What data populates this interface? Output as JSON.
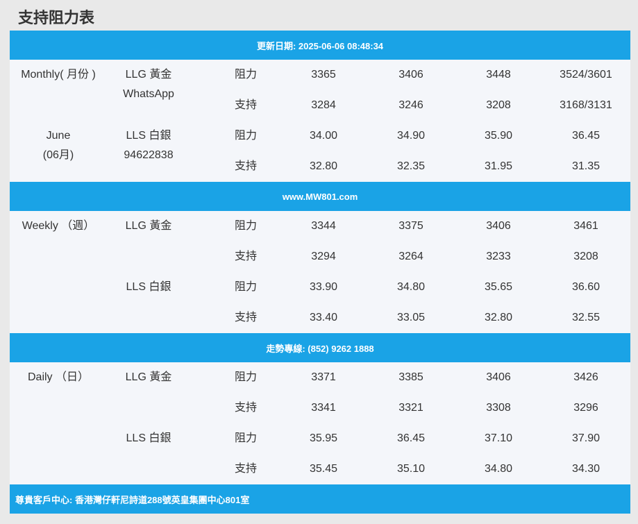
{
  "page_title": "支持阻力表",
  "header_bar": "更新日期: 2025-06-06 08:48:34",
  "mid_bar_1": "www.MW801.com",
  "mid_bar_2": "走勢專線: (852) 9262 1888",
  "footer_bar": "尊貴客戶中心: 香港灣仔軒尼詩道288號英皇集團中心801室",
  "type_labels": {
    "resistance": "阻力",
    "support": "支持"
  },
  "monthly": {
    "period_line1": "Monthly( 月份 )",
    "period_line2": "June",
    "period_line3": "(06月)",
    "gold_label": "LLG 黃金",
    "gold_sub": "WhatsApp",
    "silver_label": "LLS 白銀",
    "silver_sub": "94622838",
    "rows": [
      [
        "3365",
        "3406",
        "3448",
        "3524/3601"
      ],
      [
        "3284",
        "3246",
        "3208",
        "3168/3131"
      ],
      [
        "34.00",
        "34.90",
        "35.90",
        "36.45"
      ],
      [
        "32.80",
        "32.35",
        "31.95",
        "31.35"
      ]
    ]
  },
  "weekly": {
    "period": "Weekly （週）",
    "gold_label": "LLG 黃金",
    "silver_label": "LLS 白銀",
    "rows": [
      [
        "3344",
        "3375",
        "3406",
        "3461"
      ],
      [
        "3294",
        "3264",
        "3233",
        "3208"
      ],
      [
        "33.90",
        "34.80",
        "35.65",
        "36.60"
      ],
      [
        "33.40",
        "33.05",
        "32.80",
        "32.55"
      ]
    ]
  },
  "daily": {
    "period": "Daily （日）",
    "gold_label": "LLG 黃金",
    "silver_label": "LLS 白銀",
    "rows": [
      [
        "3371",
        "3385",
        "3406",
        "3426"
      ],
      [
        "3341",
        "3321",
        "3308",
        "3296"
      ],
      [
        "35.95",
        "36.45",
        "37.10",
        "37.90"
      ],
      [
        "35.45",
        "35.10",
        "34.80",
        "34.30"
      ]
    ]
  }
}
